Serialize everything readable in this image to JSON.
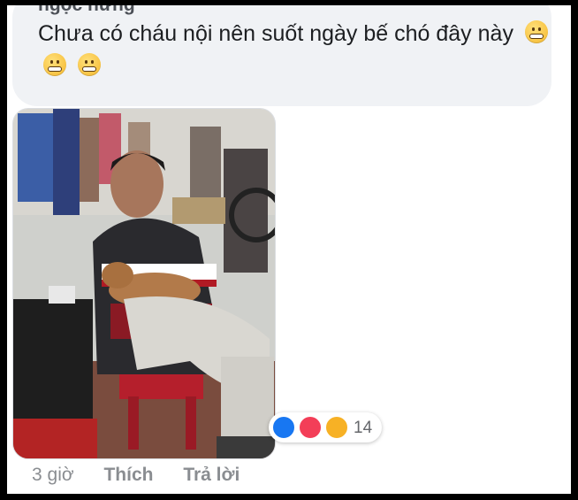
{
  "comment": {
    "author": "ngọc hưng",
    "text": "Chưa có cháu nội nên suốt ngày bế chó đây này",
    "emoji_icons": [
      "grimacing-face-icon",
      "grimacing-face-icon",
      "grimacing-face-icon"
    ],
    "photo_icon": "man-holding-dog-photo",
    "reactions": {
      "icons": [
        "like-icon",
        "love-icon",
        "haha-icon"
      ],
      "count": "14",
      "colors": {
        "like": "#1877f2",
        "love": "#f33e58",
        "haha": "#f7b125"
      }
    },
    "meta": {
      "time": "3 giờ",
      "like_label": "Thích",
      "reply_label": "Trả lời"
    }
  }
}
